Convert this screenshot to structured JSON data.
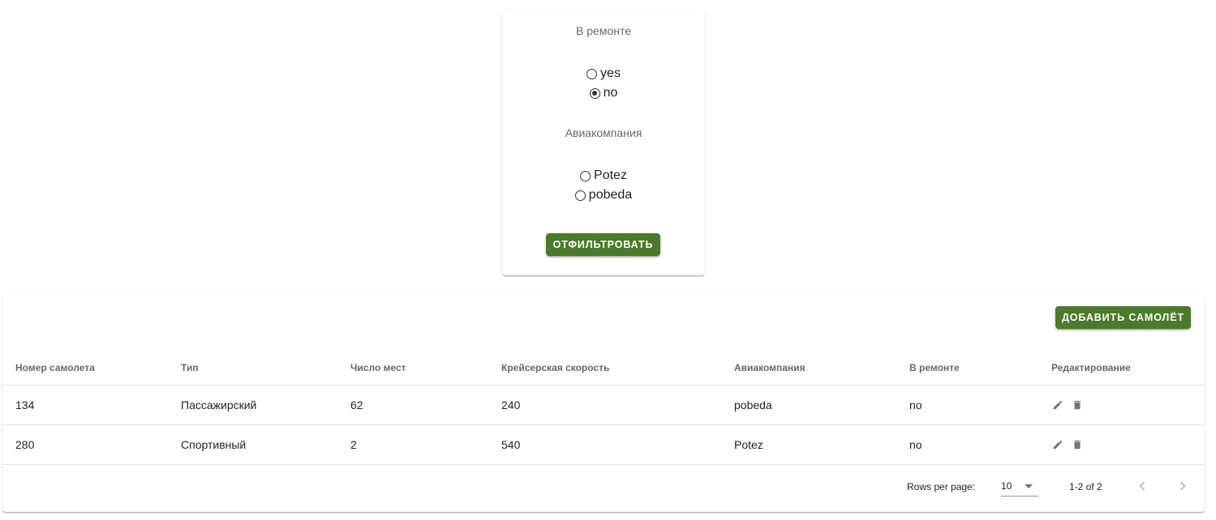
{
  "filter": {
    "repair_title": "В ремонте",
    "repair_options": [
      {
        "label": "yes",
        "checked": false
      },
      {
        "label": "no",
        "checked": true
      }
    ],
    "airline_title": "Авиакомпания",
    "airline_options": [
      {
        "label": "Potez",
        "checked": false
      },
      {
        "label": "pobeda",
        "checked": false
      }
    ],
    "button_label": "ОТФИЛЬТРОВАТЬ"
  },
  "table": {
    "add_button_label": "ДОБАВИТЬ САМОЛЁТ",
    "columns": [
      "Номер самолета",
      "Тип",
      "Число мест",
      "Крейсерская скорость",
      "Авиакомпания",
      "В ремонте",
      "Редактирование"
    ],
    "rows": [
      [
        "134",
        "Пассажирский",
        "62",
        "240",
        "pobeda",
        "no"
      ],
      [
        "280",
        "Спортивный",
        "2",
        "540",
        "Potez",
        "no"
      ]
    ],
    "row_actions": [
      "edit-icon",
      "delete-icon"
    ],
    "footer": {
      "rows_per_page_label": "Rows per page:",
      "rows_per_page_value": "10",
      "range_text": "1-2 of 2"
    }
  },
  "colors": {
    "button_bg": "#4b7a2b",
    "button_text": "#ffffff"
  }
}
